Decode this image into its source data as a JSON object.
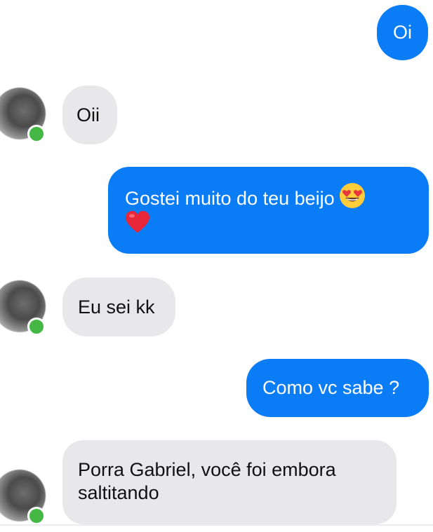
{
  "conversation": {
    "messages": [
      {
        "sender": "me",
        "text": "Oi"
      },
      {
        "sender": "contact",
        "text": "Oii"
      },
      {
        "sender": "me",
        "text": "Gostei muito do teu beijo",
        "emoji_after": "heart-eyes-emoji",
        "line2_emoji": "red-heart-emoji"
      },
      {
        "sender": "contact",
        "text": "Eu sei kk"
      },
      {
        "sender": "me",
        "text": "Como vc sabe ?"
      },
      {
        "sender": "contact",
        "text": "Porra Gabriel, você foi embora",
        "text_line2": "saltitando"
      }
    ]
  },
  "colors": {
    "outgoing_bubble": "#0a7cf6",
    "incoming_bubble": "#e8e8ea",
    "online_indicator": "#44b745",
    "background": "#ffffff"
  }
}
